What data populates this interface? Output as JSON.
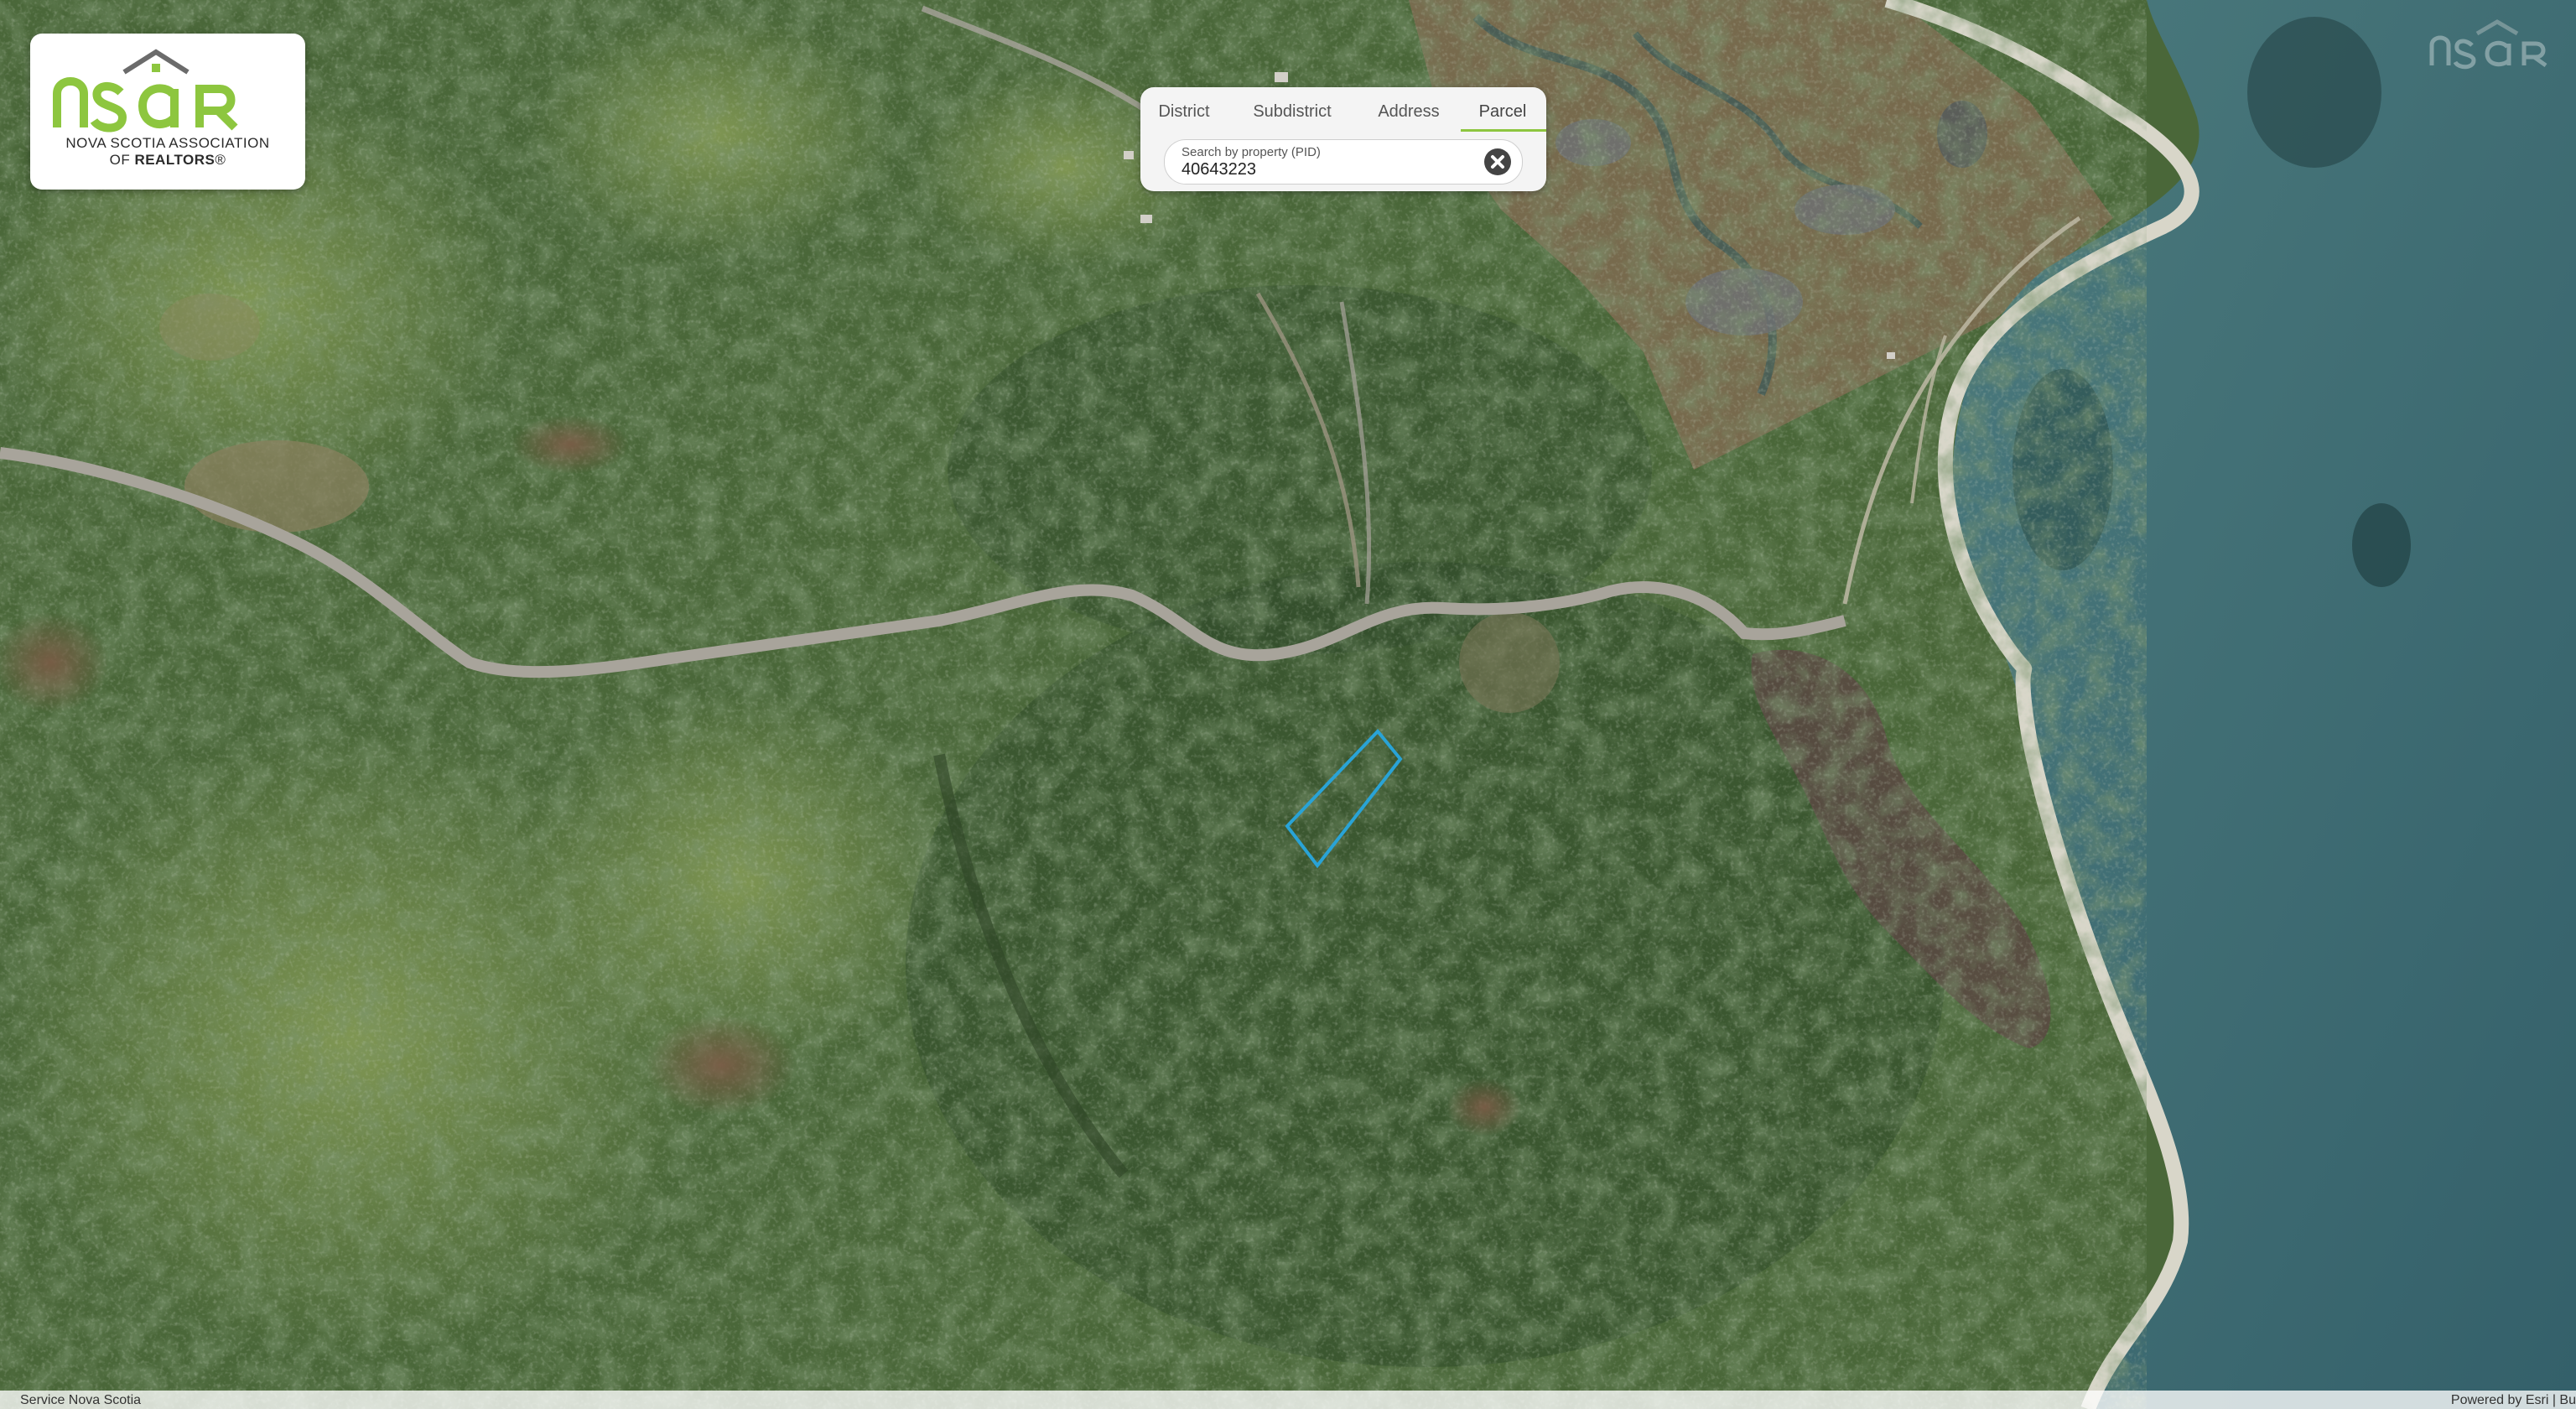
{
  "logo": {
    "brand": "nsar",
    "line1": "NOVA SCOTIA ASSOCIATION",
    "line2_prefix": "OF ",
    "line2_bold": "REALTORS",
    "line2_suffix": "®",
    "accent_color": "#8dc63f"
  },
  "search": {
    "tabs": [
      {
        "label": "District",
        "active": false
      },
      {
        "label": "Subdistrict",
        "active": false
      },
      {
        "label": "Address",
        "active": false
      },
      {
        "label": "Parcel",
        "active": true
      }
    ],
    "label": "Search by property (PID)",
    "value": "40643223",
    "clear_icon": "close-circle-icon"
  },
  "map": {
    "basemap": "satellite imagery",
    "parcel_outline_color": "#29a3d6",
    "land_color": "#4d6a3b",
    "water_color": "#3f6b70"
  },
  "attribution": {
    "left": "Service Nova Scotia",
    "right": "Powered by Esri | Bu"
  }
}
